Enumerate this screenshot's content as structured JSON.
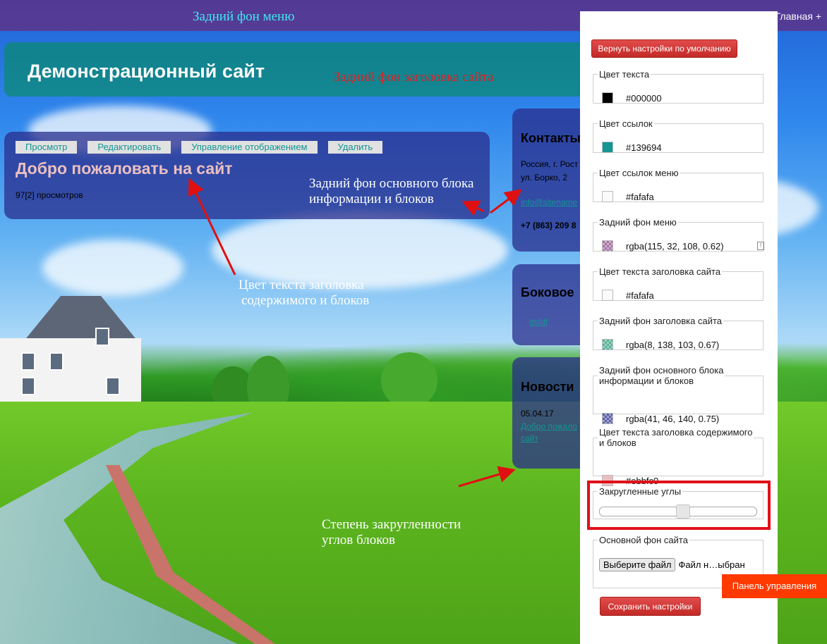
{
  "menu": {
    "home_label": "Главная +"
  },
  "header": {
    "site_title": "Демонстрационный сайт"
  },
  "main_block": {
    "tabs": [
      "Просмотр",
      "Редактировать",
      "Управление отображением",
      "Удалить"
    ],
    "heading": "Добро пожаловать на сайт",
    "views": "97[2] просмотров"
  },
  "sidebar": {
    "contacts": {
      "title": "Контакты",
      "address_line1": "Россия, г. Рост",
      "address_line2": "ул. Борко, 2",
      "email": "info@sitename",
      "phone": "+7 (863) 209 8"
    },
    "side_block": {
      "title": "Боковое",
      "link": "dsfdf"
    },
    "news": {
      "title": "Новости",
      "date": "05.04.17",
      "link_line1": "Добро пожало",
      "link_line2": "сайт"
    }
  },
  "annotations": {
    "menu_bg": "Задний фон меню",
    "header_bg": "Задний фон заголовка сайта",
    "block_bg_line1": "Задний фон основного блока",
    "block_bg_line2": "информации и блоков",
    "heading_color_line1": "Цвет текста заголовка",
    "heading_color_line2": "содержимого и блоков",
    "rounding_line1": "Степень закругленности",
    "rounding_line2": "углов блоков"
  },
  "panel": {
    "reset_label": "Вернуть настройки по умолчанию",
    "fields": [
      {
        "label": "Цвет текста",
        "value": "#000000",
        "swatch": "#000000"
      },
      {
        "label": "Цвет ссылок",
        "value": "#139694",
        "swatch": "#139694"
      },
      {
        "label": "Цвет ссылок меню",
        "value": "#fafafa",
        "swatch": "#fafafa"
      },
      {
        "label": "Задний фон меню",
        "value": "rgba(115, 32, 108, 0.62)",
        "swatch": "rgba(115,32,108,0.62)"
      },
      {
        "label": "Цвет текста заголовка сайта",
        "value": "#fafafa",
        "swatch": "#fafafa"
      },
      {
        "label": "Задний фон заголовка сайта",
        "value": "rgba(8, 138, 103, 0.67)",
        "swatch": "rgba(8,138,103,0.67)"
      },
      {
        "label_line1": "Задний фон основного блока",
        "label_line2": "информации и блоков",
        "value": "rgba(41, 46, 140, 0.75)",
        "swatch": "rgba(41,46,140,0.75)"
      },
      {
        "label_line1": "Цвет текста заголовка содержимого",
        "label_line2": "и блоков",
        "value": "#ebbfc0",
        "swatch": "#ebbfc0"
      }
    ],
    "rounded_label": "Закругленные углы",
    "rounded_value": 0.53,
    "bg_label": "Основной фон сайта",
    "file_button": "Выберите файл",
    "file_status": "Файл н…ыбран",
    "save_label": "Сохранить настройки",
    "control_tab": "Панель управления"
  }
}
